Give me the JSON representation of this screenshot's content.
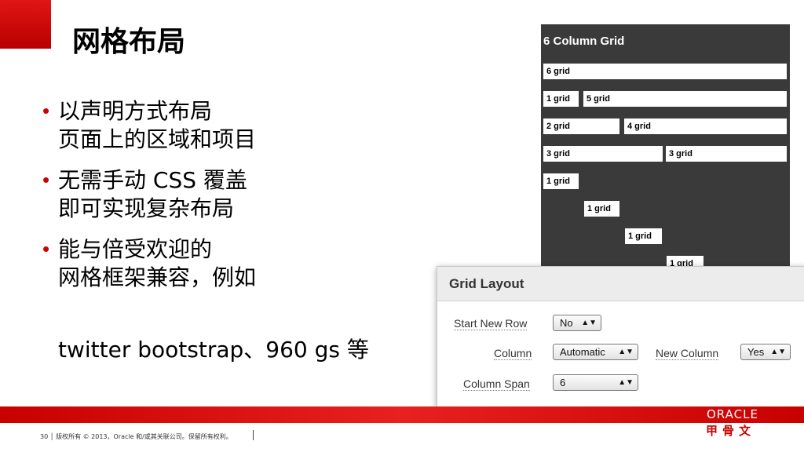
{
  "slide": {
    "title": "网格布局",
    "bullets": [
      {
        "lines": [
          "以声明方式布局",
          "页面上的区域和项目"
        ]
      },
      {
        "lines": [
          "无需手动 CSS 覆盖",
          "即可实现复杂布局"
        ]
      },
      {
        "lines": [
          "能与倍受欢迎的",
          "网格框架兼容，例如"
        ]
      }
    ],
    "bullet_extra": "twitter bootstrap、960 gs 等"
  },
  "grid_demo": {
    "title": "6 Column Grid",
    "rows": [
      [
        "6 grid"
      ],
      [
        "1 grid",
        "5 grid"
      ],
      [
        "2 grid",
        "4 grid"
      ],
      [
        "3 grid",
        "3 grid"
      ],
      [
        "1 grid"
      ],
      [
        "1 grid"
      ],
      [
        "1 grid"
      ],
      [
        "1 grid"
      ]
    ]
  },
  "dialog": {
    "title": "Grid Layout",
    "start_new_row_label": "Start New Row",
    "start_new_row_value": "No",
    "column_label": "Column",
    "column_value": "Automatic",
    "new_column_label": "New Column",
    "new_column_value": "Yes",
    "column_span_label": "Column Span",
    "column_span_value": "6",
    "arrow_glyph": "▲▼"
  },
  "footer": {
    "text": "30 │ 版权所有 © 2013，Oracle 和/或其关联公司。保留所有权利。",
    "logo_en": "ORACLE",
    "logo_cn": "甲骨文"
  },
  "colors": {
    "accent_red": "#c80000",
    "panel_dark": "#3a3a3a"
  }
}
